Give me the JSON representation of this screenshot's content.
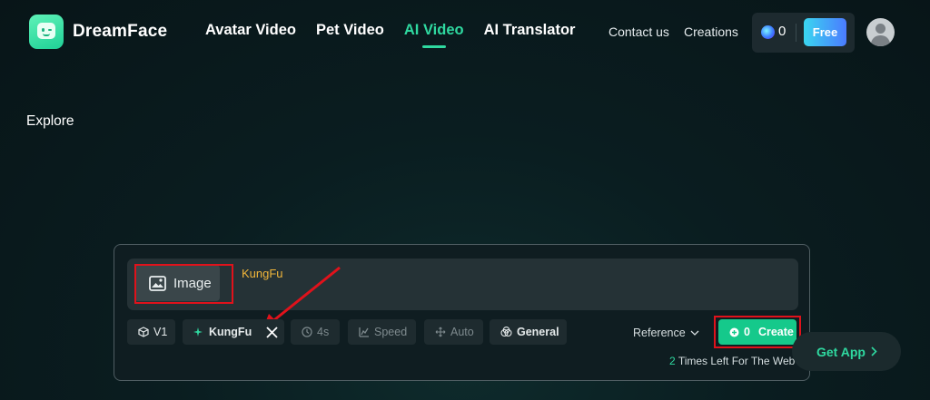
{
  "brand": {
    "name": "DreamFace"
  },
  "nav": {
    "items": [
      {
        "label": "Avatar Video"
      },
      {
        "label": "Pet Video"
      },
      {
        "label": "AI Video",
        "active": true
      },
      {
        "label": "AI Translator"
      }
    ],
    "contact_label": "Contact us",
    "creations_label": "Creations"
  },
  "credits": {
    "count": "0",
    "free_label": "Free"
  },
  "page": {
    "title": "Explore"
  },
  "composer": {
    "image_button_label": "Image",
    "prompt_text": "KungFu",
    "chips": {
      "model": "V1",
      "effect": "KungFu",
      "duration": "4s",
      "speed": "Speed",
      "motion": "Auto",
      "style": "General"
    },
    "reference_label": "Reference",
    "create_cost": "0",
    "create_label": "Create",
    "times_left_count": "2",
    "times_left_text": "Times Left For The Web"
  },
  "get_app_label": "Get App",
  "colors": {
    "accent": "#2fd9a0",
    "create_button": "#15c98b",
    "highlight_box": "#e0121b",
    "prompt_text": "#f0b53a"
  }
}
